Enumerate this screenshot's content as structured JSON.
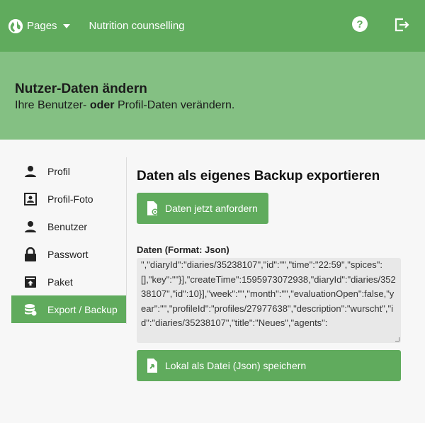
{
  "topbar": {
    "pages_label": "Pages",
    "app_title": "Nutrition counselling",
    "help_glyph": "?"
  },
  "hero": {
    "title": "Nutzer-Daten ändern",
    "subtitle_pre": "Ihre Benutzer- ",
    "subtitle_bold": "oder",
    "subtitle_post": " Profil-Daten verändern."
  },
  "sidebar": {
    "items": [
      {
        "label": "Profil",
        "icon": "person-icon"
      },
      {
        "label": "Profil-Foto",
        "icon": "photo-icon"
      },
      {
        "label": "Benutzer",
        "icon": "user-icon"
      },
      {
        "label": "Passwort",
        "icon": "lock-icon"
      },
      {
        "label": "Paket",
        "icon": "package-icon"
      },
      {
        "label": "Export / Backup",
        "icon": "database-icon",
        "active": true
      }
    ]
  },
  "main": {
    "title": "Daten als eigenes Backup exportieren",
    "request_button": "Daten jetzt anfordern",
    "data_label": "Daten (Format: Json)",
    "data_text": "\",\"diaryId\":\"diaries/35238107\",\"id\":\"\",\"time\":\"22:59\",\"spices\":[],\"key\":\"\"}],\"createTime\":1595973072938,\"diaryId\":\"diaries/35238107\",\"id\":10}],\"week\":\"\",\"month\":\"\",\"evaluationOpen\":false,\"year\":\"\",\"profileId\":\"profiles/27977638\",\"description\":\"wurscht\",\"id\":\"diaries/35238107\",\"title\":\"Neues\",\"agents\":",
    "save_button": "Lokal als Datei (Json) speichern"
  },
  "colors": {
    "primary": "#60ab5d",
    "hero": "#84c083"
  }
}
